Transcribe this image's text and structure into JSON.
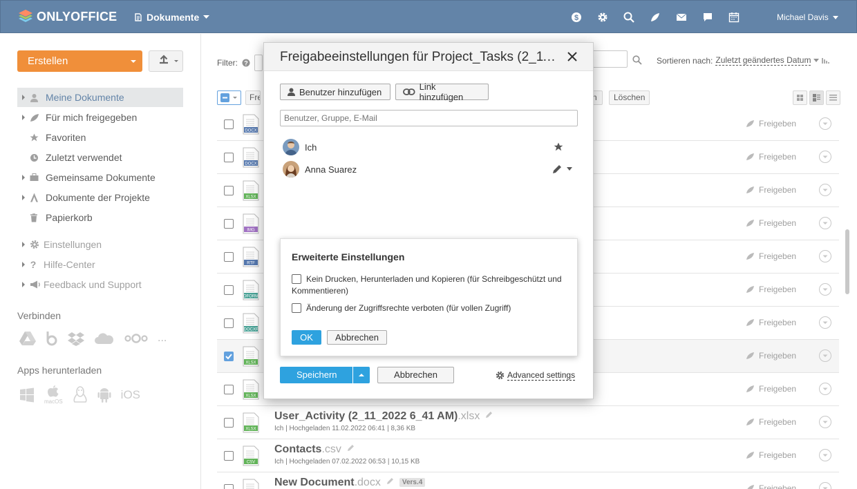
{
  "header": {
    "logo_text": "ONLYOFFICE",
    "module": "Dokumente",
    "user": "Michael Davis",
    "icons": [
      "dollar-icon",
      "gear-icon",
      "search-icon",
      "feed-icon",
      "mail-icon",
      "chat-icon",
      "calendar-icon"
    ],
    "bg_color": "#3d6693"
  },
  "sidebar": {
    "create_label": "Erstellen",
    "items": [
      {
        "label": "Meine Dokumente",
        "icon": "user-icon",
        "active": true
      },
      {
        "label": "Für mich freigegeben",
        "icon": "share-icon"
      },
      {
        "label": "Favoriten",
        "icon": "star-icon"
      },
      {
        "label": "Zuletzt verwendet",
        "icon": "clock-icon"
      },
      {
        "label": "Gemeinsame Dokumente",
        "icon": "briefcase-icon"
      },
      {
        "label": "Dokumente der Projekte",
        "icon": "projects-icon"
      },
      {
        "label": "Papierkorb",
        "icon": "trash-icon"
      }
    ],
    "extra": [
      {
        "label": "Einstellungen",
        "icon": "gear-icon"
      },
      {
        "label": "Hilfe-Center",
        "icon": "question-icon"
      },
      {
        "label": "Feedback und Support",
        "icon": "megaphone-icon"
      }
    ],
    "connect_title": "Verbinden",
    "connect_more": "...",
    "apps_title": "Apps herunterladen",
    "apps": {
      "macos": "macOS",
      "ios": "iOS"
    }
  },
  "main": {
    "filter_label": "Filter:",
    "sort_label": "Sortieren nach:",
    "sort_value": "Zuletzt geändertes Datum",
    "toolbar": {
      "share_partial": "Fre",
      "n_partial": "n",
      "delete": "Löschen"
    },
    "share_label": "Freigeben",
    "files": [
      {
        "icon": "DOCX",
        "color": "#2b579a"
      },
      {
        "icon": "DOCX",
        "color": "#2b579a"
      },
      {
        "icon": "XLSX",
        "color": "#3aa02f"
      },
      {
        "icon": "IMG",
        "color": "#8a4fb5"
      },
      {
        "icon": "RTF",
        "color": "#2b579a"
      },
      {
        "icon": "OFORM",
        "color": "#1c8b7c"
      },
      {
        "icon": "DOCXF",
        "color": "#1c8b7c"
      },
      {
        "icon": "XLSX",
        "color": "#3aa02f",
        "selected": true
      },
      {
        "icon": "XLSX",
        "color": "#3aa02f"
      },
      {
        "icon": "XLSX",
        "color": "#3aa02f",
        "name": "User_Activity (2_11_2022 6_41 AM)",
        "ext": ".xlsx",
        "meta": "Ich | Hochgeladen 11.02.2022 06:41 | 8,36 KB"
      },
      {
        "icon": "CSV",
        "color": "#3aa02f",
        "name": "Contacts",
        "ext": ".csv",
        "meta": "Ich | Hochgeladen 07.02.2022 06:53 | 10,15 KB"
      },
      {
        "icon": "DOCX",
        "color": "#2b579a",
        "name": "New Document",
        "ext": ".docx",
        "version": "Vers.4"
      }
    ]
  },
  "dialog": {
    "title": "Freigabeeinstellungen für Project_Tasks (2_11_...",
    "add_user": "Benutzer hinzufügen",
    "add_link": "Link hinzufügen",
    "search_placeholder": "Benutzer, Gruppe, E-Mail",
    "people": [
      {
        "name": "Ich",
        "role_icon": "star-icon"
      },
      {
        "name": "Anna Suarez",
        "role_icon": "pencil-icon"
      }
    ],
    "advanced": {
      "title": "Erweiterte Einstellungen",
      "opt1": "Kein Drucken, Herunterladen und Kopieren (für Schreibgeschützt und Kommentieren)",
      "opt2": "Änderung der Zugriffsrechte verboten (für vollen Zugriff)",
      "ok": "OK",
      "cancel": "Abbrechen"
    },
    "save": "Speichern",
    "cancel": "Abbrechen",
    "advanced_settings": "Advanced settings"
  }
}
